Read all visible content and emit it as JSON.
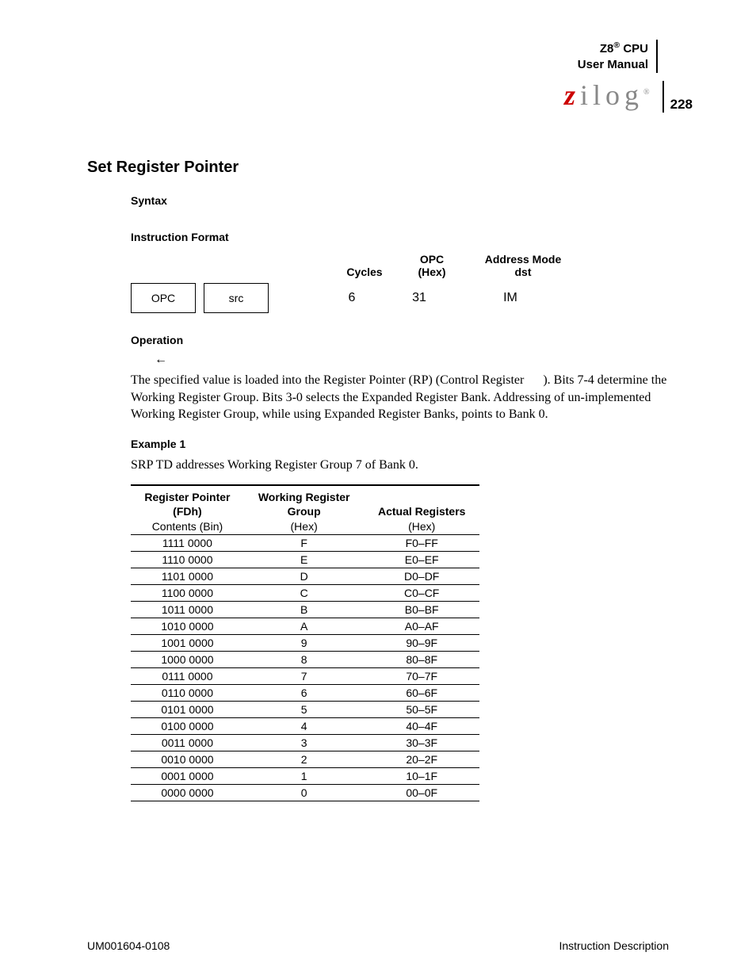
{
  "header": {
    "product": "Z8",
    "reg": "®",
    "cpu": "CPU",
    "line2": "User Manual",
    "logo_plain": "ilog",
    "logo_z": "z",
    "page_number": "228"
  },
  "title": "Set Register Pointer",
  "subheads": {
    "syntax": "Syntax",
    "instr_format": "Instruction Format",
    "operation": "Operation",
    "example1": "Example 1"
  },
  "instr": {
    "box1": "OPC",
    "box2": "src",
    "col_cycles_h": "Cycles",
    "col_opc_h1": "OPC",
    "col_opc_h2": "(Hex)",
    "col_addr_h1": "Address Mode",
    "col_addr_h2": "dst",
    "val_cycles": "6",
    "val_opc": "31",
    "val_addr": "IM"
  },
  "operation": {
    "arrow": "←",
    "para": "The specified value is loaded into the Register Pointer (RP) (Control Register      ). Bits 7-4 determine the Working Register Group. Bits 3-0 selects the Expanded Register Bank. Addressing of un-implemented Working Register Group, while using Expanded Register Banks, points to Bank 0."
  },
  "example1_line": "SRP TD addresses Working Register Group 7 of Bank 0.",
  "table": {
    "h1a": "Register Pointer",
    "h1b": "(FDh)",
    "h2a": "Working Register",
    "h2b": "Group",
    "h3b": "Actual Registers",
    "sub1": "Contents (Bin)",
    "sub2": "(Hex)",
    "sub3": "(Hex)",
    "rows": [
      {
        "c1": "1111 0000",
        "c2": "F",
        "c3": "F0–FF"
      },
      {
        "c1": "1110 0000",
        "c2": "E",
        "c3": "E0–EF"
      },
      {
        "c1": "1101 0000",
        "c2": "D",
        "c3": "D0–DF"
      },
      {
        "c1": "1100 0000",
        "c2": "C",
        "c3": "C0–CF"
      },
      {
        "c1": "1011 0000",
        "c2": "B",
        "c3": "B0–BF"
      },
      {
        "c1": "1010 0000",
        "c2": "A",
        "c3": "A0–AF"
      },
      {
        "c1": "1001 0000",
        "c2": "9",
        "c3": "90–9F"
      },
      {
        "c1": "1000 0000",
        "c2": "8",
        "c3": "80–8F"
      },
      {
        "c1": "0111 0000",
        "c2": "7",
        "c3": "70–7F"
      },
      {
        "c1": "0110 0000",
        "c2": "6",
        "c3": "60–6F"
      },
      {
        "c1": "0101 0000",
        "c2": "5",
        "c3": "50–5F"
      },
      {
        "c1": "0100 0000",
        "c2": "4",
        "c3": "40–4F"
      },
      {
        "c1": "0011 0000",
        "c2": "3",
        "c3": "30–3F"
      },
      {
        "c1": "0010 0000",
        "c2": "2",
        "c3": "20–2F"
      },
      {
        "c1": "0001 0000",
        "c2": "1",
        "c3": "10–1F"
      },
      {
        "c1": "0000 0000",
        "c2": "0",
        "c3": "00–0F"
      }
    ]
  },
  "footer": {
    "left": "UM001604-0108",
    "right": "Instruction Description"
  }
}
